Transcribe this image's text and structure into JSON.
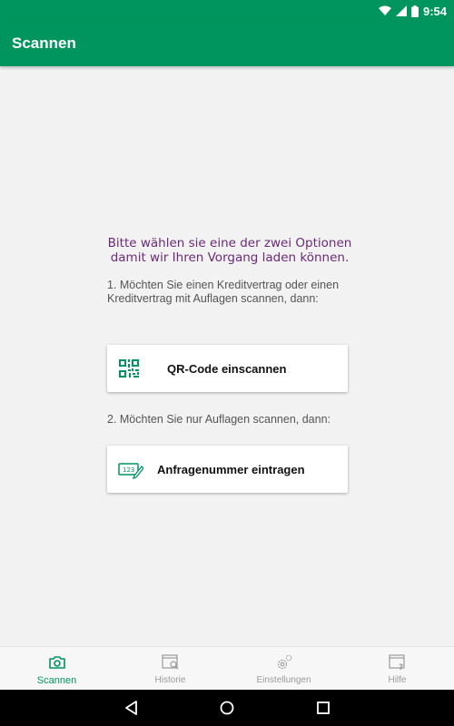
{
  "status_bar": {
    "time": "9:54"
  },
  "app_bar": {
    "title": "Scannen"
  },
  "content": {
    "prompt_line1": "Bitte wählen sie eine der zwei Optionen",
    "prompt_line2": "damit wir Ihren Vorgang laden können.",
    "option1_text": "1. Möchten Sie einen Kreditvertrag oder einen Kreditvertrag mit Auflagen scannen, dann:",
    "qr_button_label": "QR-Code einscannen",
    "option2_text": "2. Möchten Sie nur Auflagen scannen, dann:",
    "request_button_label": "Anfragenummer eintragen"
  },
  "bottom_nav": {
    "items": [
      {
        "label": "Scannen",
        "icon": "camera-icon",
        "active": true
      },
      {
        "label": "Historie",
        "icon": "history-search-icon",
        "active": false
      },
      {
        "label": "Einstellungen",
        "icon": "settings-gear-icon",
        "active": false
      },
      {
        "label": "Hilfe",
        "icon": "help-icon",
        "active": false
      }
    ]
  },
  "colors": {
    "primary": "#00955e",
    "prompt": "#6b2a78",
    "inactive": "#9a9a9a"
  }
}
